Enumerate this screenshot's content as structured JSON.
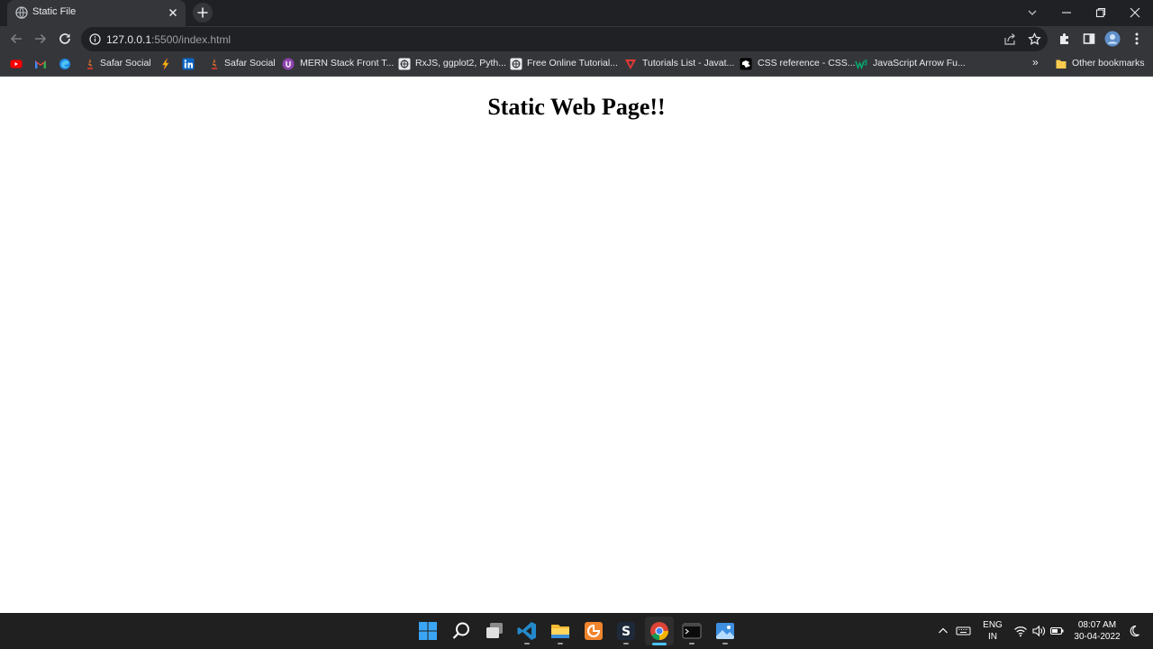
{
  "browser": {
    "tab": {
      "title": "Static File"
    },
    "address": {
      "host": "127.0.0.1",
      "path": ":5500/index.html"
    },
    "bookmarks": [
      {
        "label": "",
        "icon": "youtube-icon"
      },
      {
        "label": "",
        "icon": "gmail-icon"
      },
      {
        "label": "",
        "icon": "edge-icon"
      },
      {
        "label": "Safar Social",
        "icon": "safar-social-icon"
      },
      {
        "label": "",
        "icon": "bolt-icon"
      },
      {
        "label": "",
        "icon": "linkedin-icon"
      },
      {
        "label": "Safar Social",
        "icon": "safar-social-icon"
      },
      {
        "label": "MERN Stack Front T...",
        "icon": "mern-icon"
      },
      {
        "label": "RxJS, ggplot2, Pyth...",
        "icon": "tutorial-icon"
      },
      {
        "label": "Free Online Tutorial...",
        "icon": "tutorial-icon"
      },
      {
        "label": "Tutorials List - Javat...",
        "icon": "javatpoint-icon"
      },
      {
        "label": "CSS reference - CSS...",
        "icon": "mdn-icon"
      },
      {
        "label": "JavaScript Arrow Fu...",
        "icon": "w3schools-icon"
      }
    ],
    "overflow_label": "»",
    "other_bookmarks": "Other bookmarks"
  },
  "page": {
    "heading": "Static Web Page!!"
  },
  "taskbar": {
    "lang_line1": "ENG",
    "lang_line2": "IN",
    "time": "08:07 AM",
    "date": "30-04-2022"
  },
  "colors": {
    "tabstrip": "#202124",
    "toolbar": "#35363a",
    "omnibox": "#202124",
    "taskbar": "#202020",
    "accent": "#4cc2ff"
  }
}
